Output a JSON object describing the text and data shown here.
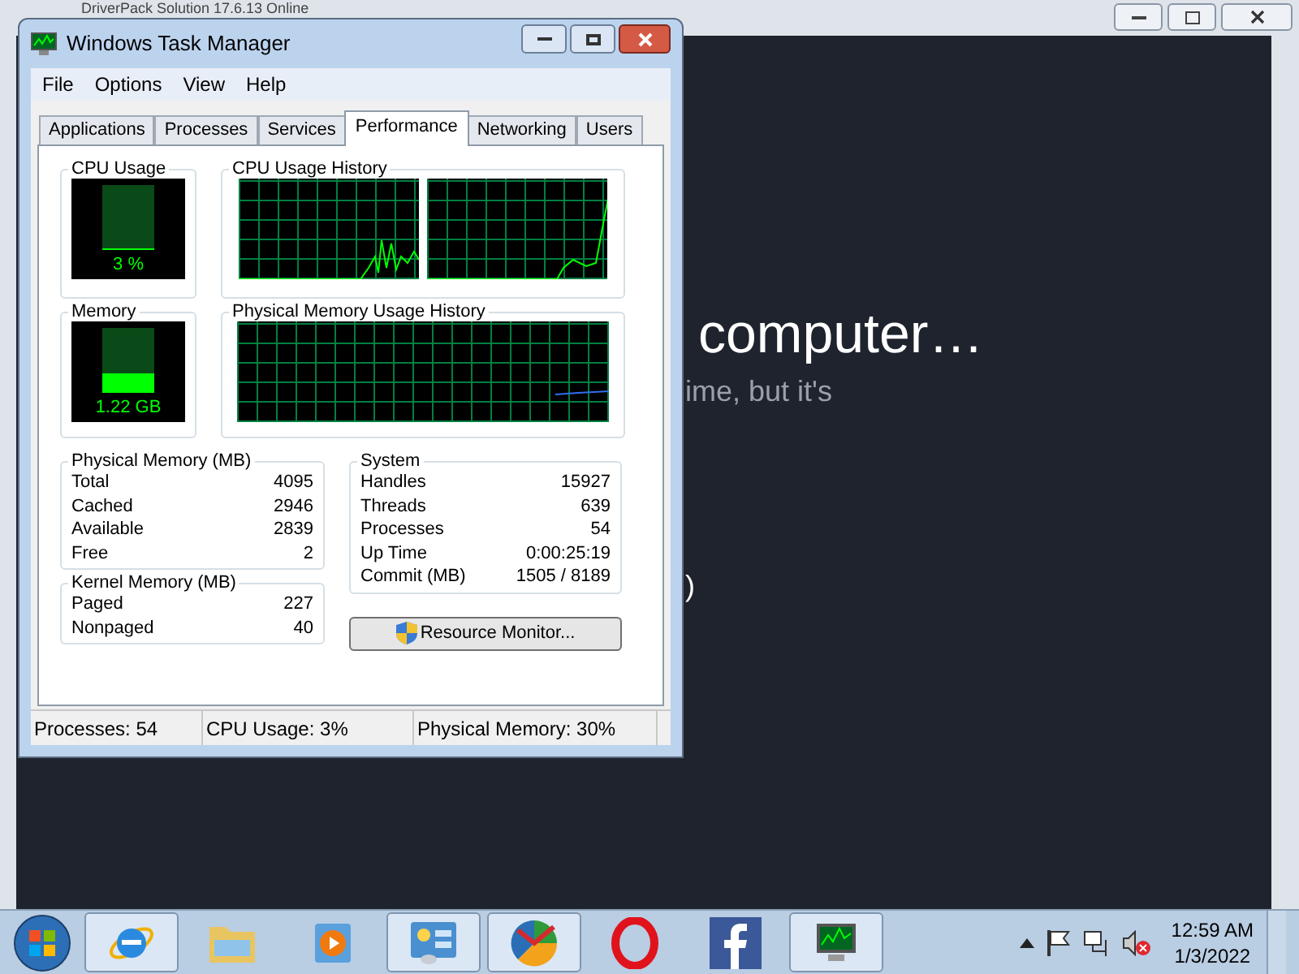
{
  "background_window": {
    "title": "DriverPack Solution 17.6.13 Online",
    "heading": "computer…",
    "subtext": "ime, but it's",
    "fragment": ")"
  },
  "window": {
    "title": "Windows Task Manager"
  },
  "menu": [
    "File",
    "Options",
    "View",
    "Help"
  ],
  "tabs": [
    {
      "label": "Applications",
      "selected": false
    },
    {
      "label": "Processes",
      "selected": false
    },
    {
      "label": "Services",
      "selected": false
    },
    {
      "label": "Performance",
      "selected": true
    },
    {
      "label": "Networking",
      "selected": false
    },
    {
      "label": "Users",
      "selected": false
    }
  ],
  "cpu_usage": {
    "title": "CPU Usage",
    "reading": "3 %",
    "level": 0.03
  },
  "cpu_history": {
    "title": "CPU Usage History"
  },
  "memory": {
    "title": "Memory",
    "reading": "1.22 GB",
    "level": 0.3
  },
  "memory_history": {
    "title": "Physical Memory Usage History"
  },
  "physical_memory": {
    "title": "Physical Memory (MB)",
    "rows": [
      {
        "label": "Total",
        "value": "4095"
      },
      {
        "label": "Cached",
        "value": "2946"
      },
      {
        "label": "Available",
        "value": "2839"
      },
      {
        "label": "Free",
        "value": "2"
      }
    ]
  },
  "kernel_memory": {
    "title": "Kernel Memory (MB)",
    "rows": [
      {
        "label": "Paged",
        "value": "227"
      },
      {
        "label": "Nonpaged",
        "value": "40"
      }
    ]
  },
  "system": {
    "title": "System",
    "rows": [
      {
        "label": "Handles",
        "value": "15927"
      },
      {
        "label": "Threads",
        "value": "639"
      },
      {
        "label": "Processes",
        "value": "54"
      },
      {
        "label": "Up Time",
        "value": "0:00:25:19"
      },
      {
        "label": "Commit (MB)",
        "value": "1505 / 8189"
      }
    ]
  },
  "resource_monitor_button": "Resource Monitor...",
  "status_bar": [
    "Processes: 54",
    "CPU Usage: 3%",
    "Physical Memory: 30%"
  ],
  "taskbar": {
    "items": [
      {
        "kind": "browser",
        "running": true
      },
      {
        "kind": "folder",
        "running": false
      },
      {
        "kind": "media",
        "running": false
      },
      {
        "kind": "panel",
        "running": true
      },
      {
        "kind": "wheel",
        "running": true
      },
      {
        "kind": "ring",
        "running": false
      },
      {
        "kind": "social",
        "running": false
      },
      {
        "kind": "monitor",
        "running": true
      }
    ],
    "clock": {
      "time": "12:59 AM",
      "date": "1/3/2022"
    }
  }
}
